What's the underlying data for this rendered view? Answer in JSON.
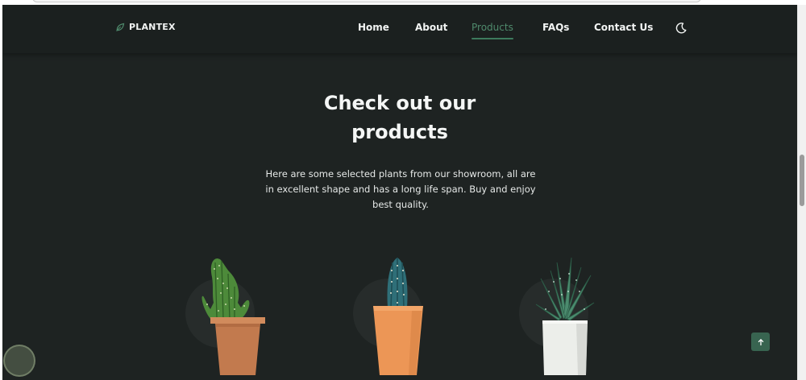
{
  "brand": {
    "name": "PLANTEX",
    "icon": "leaf-icon",
    "accent_color": "#3d7a5d"
  },
  "nav": {
    "items": [
      {
        "label": "Home",
        "active": false
      },
      {
        "label": "About",
        "active": false
      },
      {
        "label": "Products",
        "active": true
      },
      {
        "label": "FAQs",
        "active": false
      },
      {
        "label": "Contact Us",
        "active": false
      }
    ],
    "theme_toggle_icon": "moon-icon"
  },
  "section": {
    "title_line1": "Check out our",
    "title_line2": "products",
    "description": "Here are some selected plants from our showroom, all are in excellent shape and has a long life span. Buy and enjoy best quality."
  },
  "products": [
    {
      "image": "cactus-in-terracotta-pot"
    },
    {
      "image": "blue-cactus-in-orange-pot"
    },
    {
      "image": "aloe-in-white-pot"
    }
  ],
  "scroll_top": {
    "icon": "arrow-up-icon",
    "color": "#386450"
  },
  "colors": {
    "background": "#1e2322",
    "header": "#1b201f",
    "text": "#f4f6f5",
    "active_link": "#4f8a6c"
  }
}
